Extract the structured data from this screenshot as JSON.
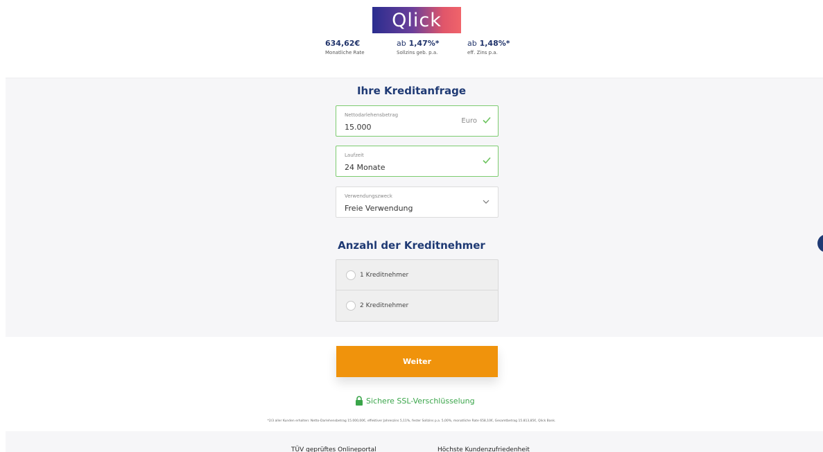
{
  "header": {
    "logo_text": "Qlick",
    "stats": [
      {
        "value": "634,62€",
        "prefix": "",
        "label": "Monatliche Rate"
      },
      {
        "value": "1,47%*",
        "prefix": "ab",
        "label": "Sollzins geb. p.a."
      },
      {
        "value": "1,48%*",
        "prefix": "ab",
        "label": "eff. Zins p.a."
      }
    ]
  },
  "form": {
    "title": "Ihre Kreditanfrage",
    "fields": [
      {
        "label": "Nettodarlehensbetrag",
        "value": "15.000",
        "unit": "Euro",
        "status_icon": "check-icon"
      },
      {
        "label": "Laufzeit",
        "value": "24 Monate",
        "status_icon": "check-icon"
      },
      {
        "label": "Verwendungszweck",
        "value": "Freie Verwendung",
        "status_icon": "chevron-down-icon"
      }
    ],
    "borrowers_title": "Anzahl der Kreditnehmer",
    "borrower_options": [
      {
        "label": "1 Kreditnehmer",
        "selected": false
      },
      {
        "label": "2 Kreditnehmer",
        "selected": false
      }
    ]
  },
  "actions": {
    "continue_label": "Weiter",
    "ssl_label": "Sichere SSL-Verschlüsselung",
    "disclaimer": "*2/3 aller Kunden erhalten: Netto-Darlehensbetrag 15.000,00€, effektiver Jahreszins 5,11%, fester Sollzins p.a. 5,00%, monatliche Rate 658,10€, Gesamtbetrag 15.813,85€, Qlick Bank."
  },
  "footer": {
    "items": [
      "TÜV geprüftes Onlineportal",
      "Höchste Kundenzufriedenheit"
    ]
  },
  "colors": {
    "brand_navy": "#1f3a74",
    "accent_orange": "#f0930c",
    "success_green": "#7ccb6f",
    "ssl_green": "#3aa54a"
  }
}
